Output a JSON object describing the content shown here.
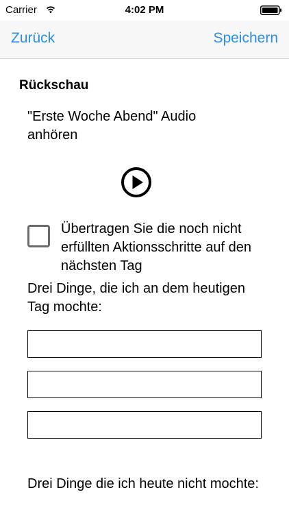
{
  "status_bar": {
    "carrier": "Carrier",
    "time": "4:02 PM",
    "icons": [
      "wifi-icon",
      "battery-icon"
    ]
  },
  "nav": {
    "back_label": "Zurück",
    "save_label": "Speichern",
    "accent_color": "#2b8ee8"
  },
  "content": {
    "section_title": "Rückschau",
    "audio_text": "\"Erste Woche Abend\" Audio anhören",
    "play_icon": "play-circle-icon",
    "transfer_checkbox": {
      "label": "Übertragen Sie die noch nicht erfüllten Aktionsschritte auf den nächsten Tag",
      "checked": false
    },
    "liked_question": "Drei Dinge, die ich an dem heutigen Tag mochte:",
    "liked_fields": [
      {
        "value": ""
      },
      {
        "value": ""
      },
      {
        "value": ""
      }
    ],
    "disliked_question": "Drei Dinge die ich heute nicht mochte:"
  }
}
